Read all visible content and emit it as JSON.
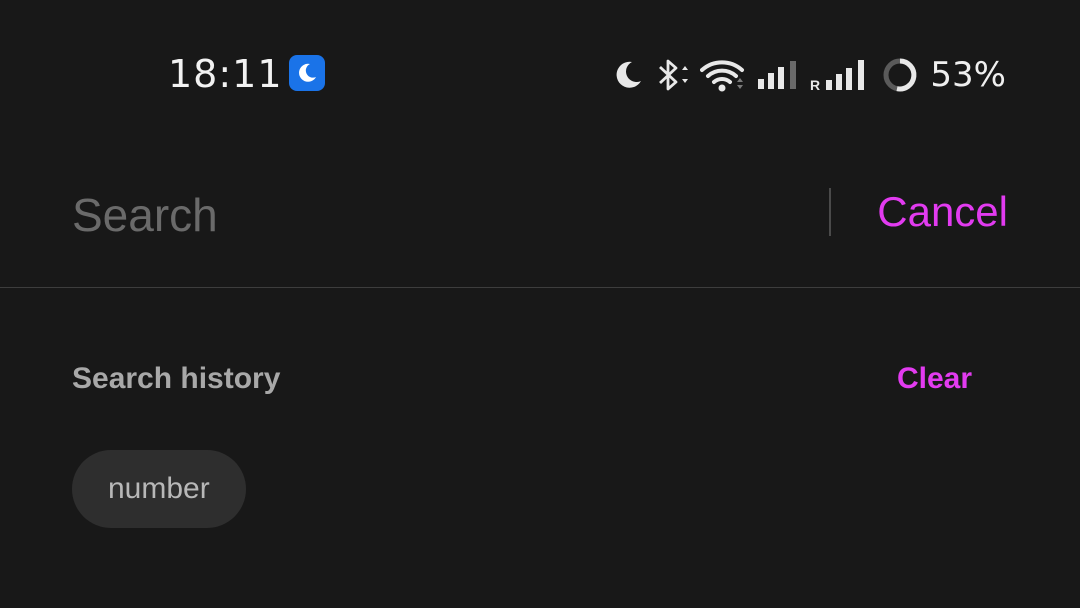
{
  "status_bar": {
    "time": "18:11",
    "dnd_icon": "moon-badge-icon",
    "icons": [
      "moon-icon",
      "bluetooth-icon",
      "wifi-icon",
      "signal-icon",
      "roaming-signal-icon",
      "battery-ring-icon"
    ],
    "roaming_label": "R",
    "battery": "53%"
  },
  "search": {
    "placeholder": "Search",
    "value": "",
    "cancel_label": "Cancel"
  },
  "history": {
    "title": "Search history",
    "clear_label": "Clear",
    "items": [
      {
        "label": "number"
      }
    ]
  },
  "colors": {
    "background": "#181818",
    "accent": "#e23bf0",
    "dnd_badge": "#1a73e8"
  }
}
